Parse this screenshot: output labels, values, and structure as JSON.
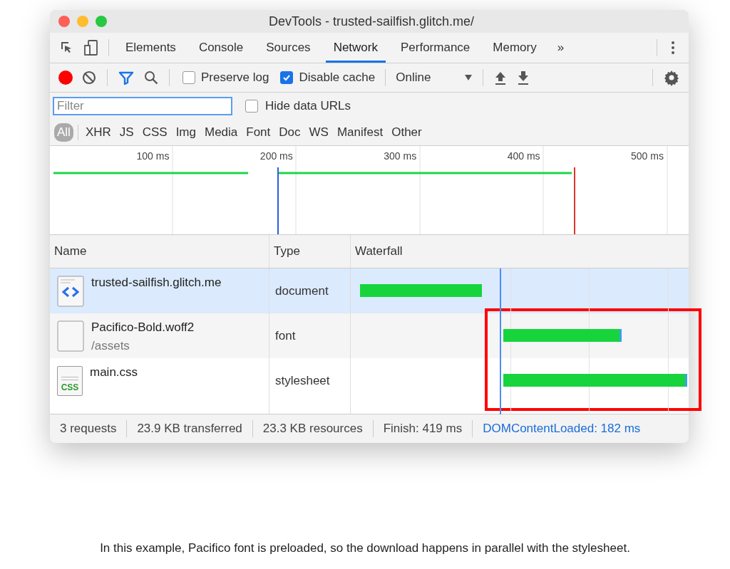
{
  "window": {
    "title": "DevTools - trusted-sailfish.glitch.me/"
  },
  "tabs": [
    {
      "label": "Elements",
      "selected": false
    },
    {
      "label": "Console",
      "selected": false
    },
    {
      "label": "Sources",
      "selected": false
    },
    {
      "label": "Network",
      "selected": true
    },
    {
      "label": "Performance",
      "selected": false
    },
    {
      "label": "Memory",
      "selected": false
    }
  ],
  "more_tabs": "»",
  "toolbar": {
    "recording": true,
    "filter_active": true,
    "checkboxes": [
      {
        "label": "Preserve log",
        "checked": false
      },
      {
        "label": "Disable cache",
        "checked": true
      }
    ],
    "throttling": "Online"
  },
  "filter_bar": {
    "placeholder": "Filter",
    "hide_data_urls": {
      "label": "Hide data URLs",
      "checked": false
    }
  },
  "type_filters": [
    {
      "label": "All",
      "selected": true
    },
    {
      "label": "XHR",
      "selected": false
    },
    {
      "label": "JS",
      "selected": false
    },
    {
      "label": "CSS",
      "selected": false
    },
    {
      "label": "Img",
      "selected": false
    },
    {
      "label": "Media",
      "selected": false
    },
    {
      "label": "Font",
      "selected": false
    },
    {
      "label": "Doc",
      "selected": false
    },
    {
      "label": "WS",
      "selected": false
    },
    {
      "label": "Manifest",
      "selected": false
    },
    {
      "label": "Other",
      "selected": false
    }
  ],
  "overview": {
    "ticks": [
      "100 ms",
      "200 ms",
      "300 ms",
      "400 ms",
      "500 ms"
    ]
  },
  "table": {
    "columns": [
      "Name",
      "Type",
      "Waterfall"
    ],
    "rows": [
      {
        "name": "trusted-sailfish.glitch.me",
        "type": "document",
        "kind": "document",
        "selected": true
      },
      {
        "name": "Pacifico-Bold.woff2",
        "path": "/assets",
        "type": "font",
        "kind": "font",
        "selected": false
      },
      {
        "name": "main.css",
        "type": "stylesheet",
        "kind": "stylesheet",
        "icon_label": "CSS",
        "selected": false
      }
    ]
  },
  "status_bar": {
    "items": [
      "3 requests",
      "23.9 KB transferred",
      "23.3 KB resources",
      "Finish: 419 ms"
    ],
    "dom_content_loaded": "DOMContentLoaded: 182 ms"
  },
  "caption": "In this example, Pacifico font is preloaded, so the download happens in parallel with the stylesheet."
}
